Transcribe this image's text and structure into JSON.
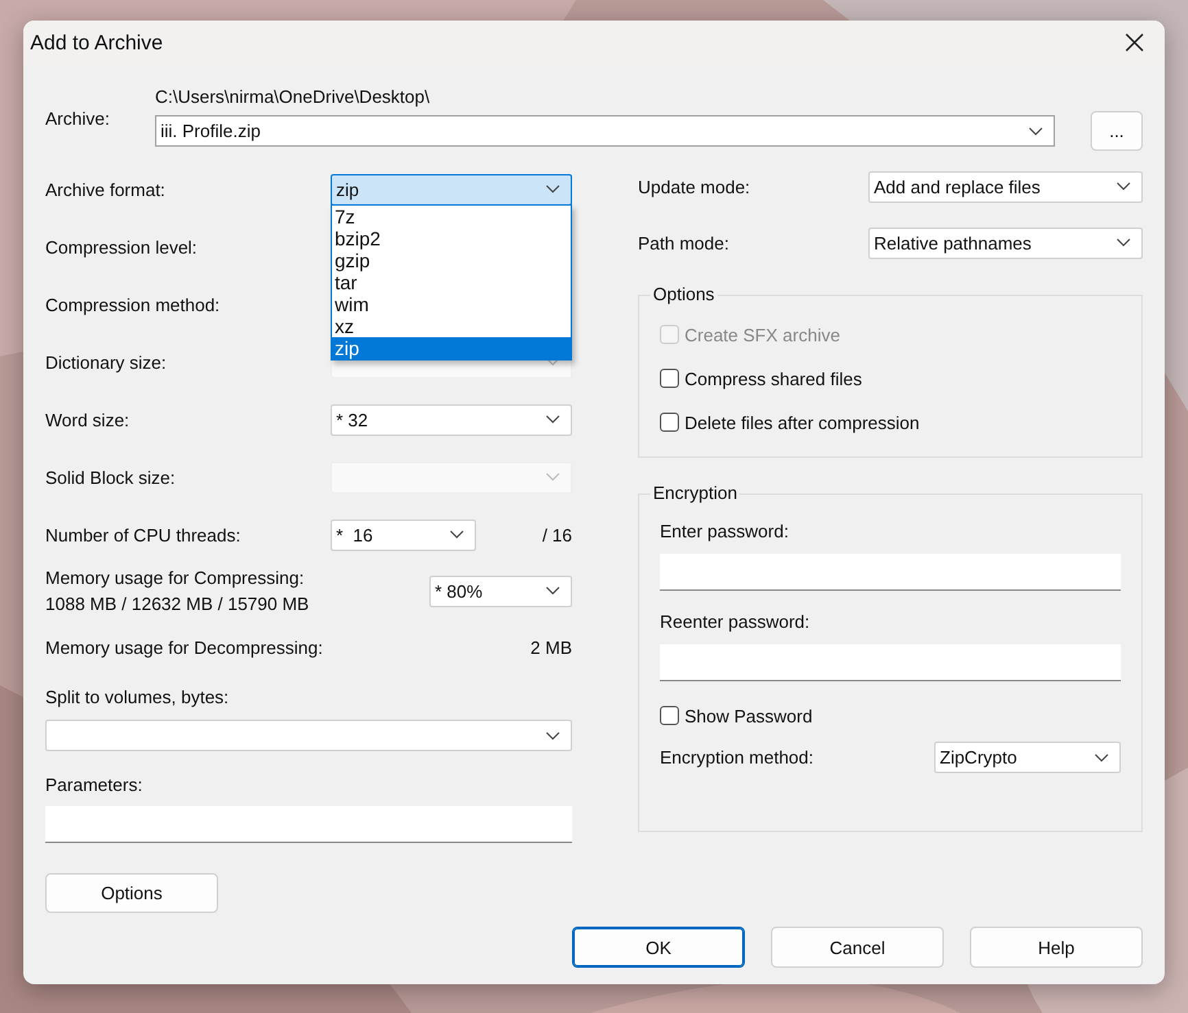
{
  "window": {
    "title": "Add to Archive"
  },
  "archive": {
    "label": "Archive:",
    "path": "C:\\Users\\nirma\\OneDrive\\Desktop\\",
    "value": "iii. Profile.zip",
    "browse_button": "..."
  },
  "archive_format": {
    "label": "Archive format:",
    "value": "zip",
    "open": true,
    "options": [
      {
        "label": "7z",
        "selected": false
      },
      {
        "label": "bzip2",
        "selected": false
      },
      {
        "label": "gzip",
        "selected": false
      },
      {
        "label": "tar",
        "selected": false
      },
      {
        "label": "wim",
        "selected": false
      },
      {
        "label": "xz",
        "selected": false
      },
      {
        "label": "zip",
        "selected": true
      }
    ]
  },
  "settings": [
    {
      "kind": "label",
      "label": "Compression level:"
    },
    {
      "kind": "label",
      "label": "Compression method:"
    },
    {
      "kind": "combo",
      "label": "Dictionary size:",
      "disabled": true
    },
    {
      "kind": "combo",
      "label": "Word size:",
      "value": "*  32",
      "disabled": false
    },
    {
      "kind": "combo",
      "label": "Solid Block size:",
      "disabled": true
    },
    {
      "kind": "threads",
      "label": "Number of CPU threads:",
      "value": "*  16",
      "reading": "/ 16"
    },
    {
      "kind": "memory",
      "label": "Memory usage for Compressing:",
      "detail": "1088 MB / 12632 MB / 15790 MB",
      "value": "* 80%"
    },
    {
      "kind": "reading",
      "label": "Memory usage for Decompressing:",
      "reading": "2 MB"
    }
  ],
  "split": {
    "label": "Split to volumes, bytes:"
  },
  "parameters": {
    "label": "Parameters:"
  },
  "options_button": "Options",
  "update_mode": {
    "label": "Update mode:",
    "value": "Add and replace files"
  },
  "path_mode": {
    "label": "Path mode:",
    "value": "Relative pathnames"
  },
  "options_group": {
    "title": "Options",
    "checkboxes": [
      {
        "label": "Create SFX archive",
        "checked": false,
        "disabled": true
      },
      {
        "label": "Compress shared files",
        "checked": false,
        "disabled": false
      },
      {
        "label": "Delete files after compression",
        "checked": false,
        "disabled": false
      }
    ]
  },
  "encryption": {
    "title": "Encryption",
    "password_fields": [
      {
        "label": "Enter password:"
      },
      {
        "label": "Reenter password:"
      }
    ],
    "show_password": {
      "label": "Show Password",
      "checked": false
    },
    "method": {
      "label": "Encryption method:",
      "value": "ZipCrypto"
    }
  },
  "buttons": [
    {
      "label": "OK",
      "default": true
    },
    {
      "label": "Cancel",
      "default": false
    },
    {
      "label": "Help",
      "default": false
    }
  ]
}
